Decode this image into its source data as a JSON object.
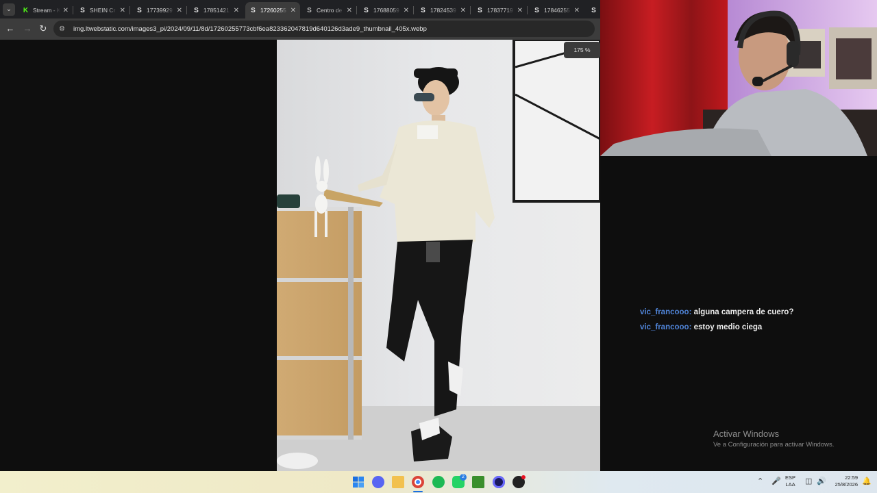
{
  "tabs": [
    {
      "label": "Stream - K",
      "favicon": "kick-logo-icon"
    },
    {
      "label": "SHEIN Cr",
      "favicon": "shein-s-icon"
    },
    {
      "label": "17739929",
      "favicon": "shein-s-icon"
    },
    {
      "label": "17851421",
      "favicon": "shein-s-icon"
    },
    {
      "label": "17260255",
      "favicon": "shein-s-icon",
      "active": true
    },
    {
      "label": "Centro de",
      "favicon": "settings-icon"
    },
    {
      "label": "17688059",
      "favicon": "shein-s-icon"
    },
    {
      "label": "17824539",
      "favicon": "shein-s-icon"
    },
    {
      "label": "17837719",
      "favicon": "shein-s-icon"
    },
    {
      "label": "17846255",
      "favicon": "shein-s-icon"
    }
  ],
  "address_bar": {
    "url": "img.ltwebstatic.com/images3_pi/2024/09/11/8d/17260255773cbf6ea823362047819d640126d3ade9_thumbnail_405x.webp"
  },
  "zoom": "175 %",
  "chat": {
    "messages": [
      {
        "user": "vic_francooo:",
        "text": "alguna campera de cuero?"
      },
      {
        "user": "vic_francooo:",
        "text": "estoy medio ciega"
      }
    ]
  },
  "watermark": {
    "title": "Activar Windows",
    "subtitle": "Ve a Configuración para activar Windows."
  },
  "taskbar": {
    "lang_line1": "ESP",
    "lang_line2": "LAA",
    "time": "22:59",
    "date": "25/8/2026",
    "whatsapp_badge": "2"
  },
  "colors": {
    "chat_username": "#4f83d6",
    "tab_bar": "#202124",
    "toolbar": "#3c3c3c"
  }
}
